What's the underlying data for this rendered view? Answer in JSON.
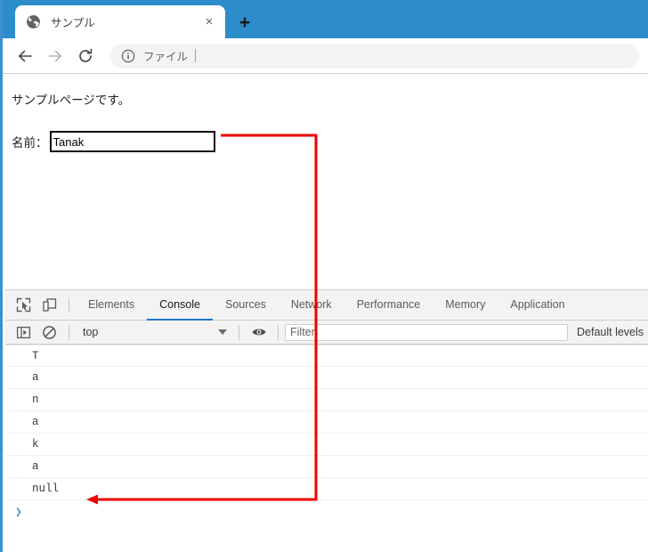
{
  "browser": {
    "tab": {
      "title": "サンプル",
      "favicon_icon": "globe-icon",
      "close_icon": "×"
    },
    "new_tab_label": "+",
    "toolbar": {
      "back_icon": "arrow-left-icon",
      "forward_icon": "arrow-right-icon",
      "reload_icon": "reload-icon",
      "omnibox": {
        "info_icon": "info-circle-icon",
        "text": "ファイル"
      }
    }
  },
  "page": {
    "paragraph": "サンプルページです。",
    "form": {
      "label": "名前：",
      "input_value": "Tanak",
      "input_placeholder": ""
    }
  },
  "devtools": {
    "toolbar_icons": {
      "inspect": "inspect-element-icon",
      "device": "device-toolbar-icon"
    },
    "tabs": [
      {
        "label": "Elements",
        "active": false
      },
      {
        "label": "Console",
        "active": true
      },
      {
        "label": "Sources",
        "active": false
      },
      {
        "label": "Network",
        "active": false
      },
      {
        "label": "Performance",
        "active": false
      },
      {
        "label": "Memory",
        "active": false
      },
      {
        "label": "Application",
        "active": false
      }
    ],
    "console_toolbar": {
      "sidebar_icon": "console-sidebar-icon",
      "clear_icon": "clear-console-icon",
      "context": "top",
      "eye_icon": "live-expression-eye-icon",
      "filter_placeholder": "Filter",
      "filter_value": "",
      "levels_label": "Default levels"
    },
    "console_messages": [
      "T",
      "a",
      "n",
      "a",
      "k",
      "a",
      "null"
    ],
    "prompt_chevron": "❯"
  },
  "annotation": {
    "color": "#ee0000",
    "description": "arrow from name input to null console output"
  }
}
